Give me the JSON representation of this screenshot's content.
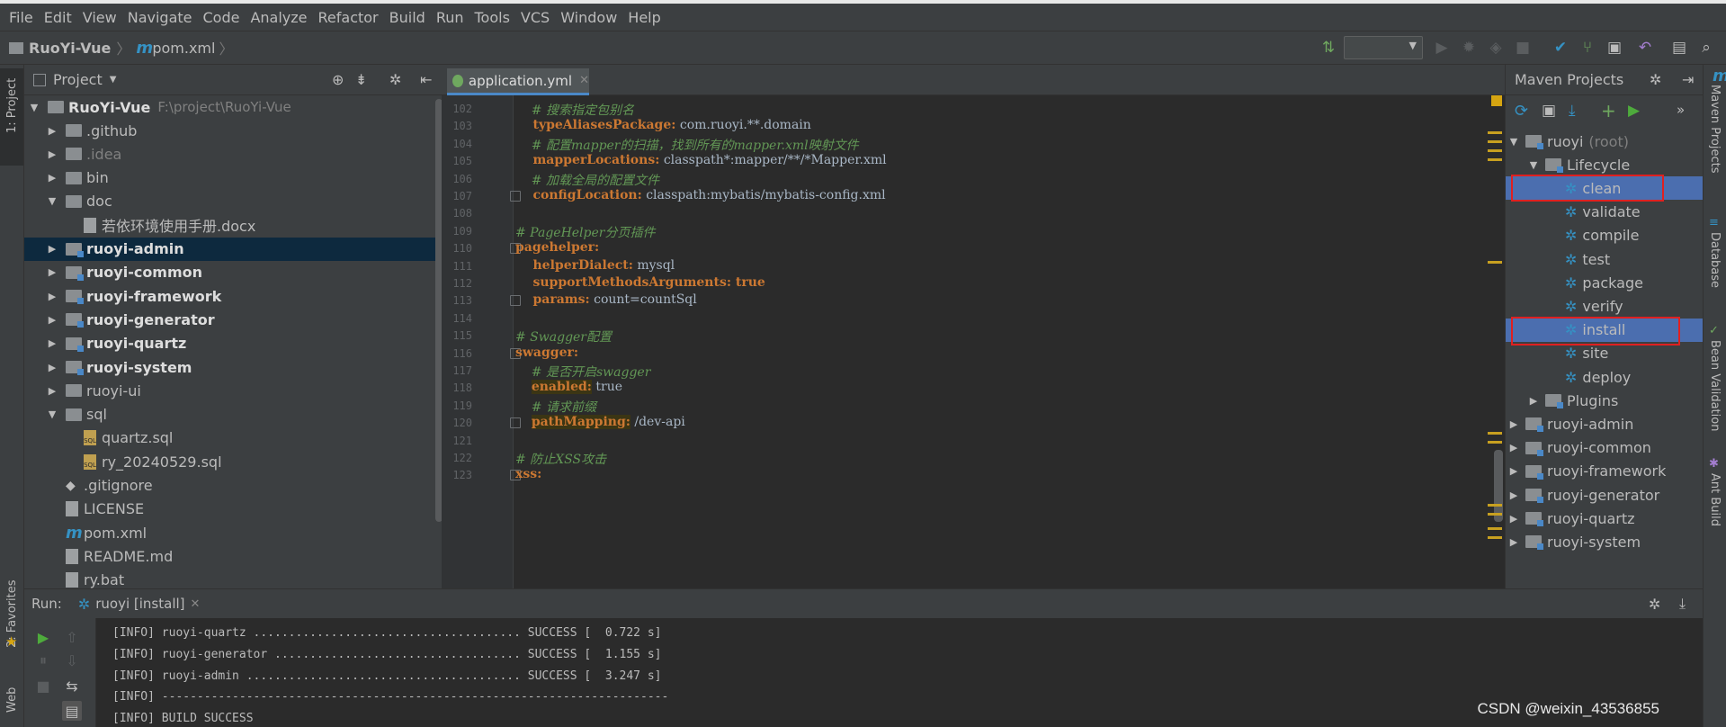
{
  "menu": [
    "File",
    "Edit",
    "View",
    "Navigate",
    "Code",
    "Analyze",
    "Refactor",
    "Build",
    "Run",
    "Tools",
    "VCS",
    "Window",
    "Help"
  ],
  "breadcrumb": {
    "project": "RuoYi-Vue",
    "file": "pom.xml"
  },
  "left_strip": {
    "project_tab": "1: Project",
    "favorites_tab": "2: Favorites",
    "web_tab": "Web"
  },
  "project_panel": {
    "title": "Project",
    "root_name": "RuoYi-Vue",
    "root_path": "F:\\project\\RuoYi-Vue",
    "items": [
      {
        "label": ".github"
      },
      {
        "label": ".idea"
      },
      {
        "label": "bin"
      },
      {
        "label": "doc"
      },
      {
        "label": "若依环境使用手册.docx"
      },
      {
        "label": "ruoyi-admin"
      },
      {
        "label": "ruoyi-common"
      },
      {
        "label": "ruoyi-framework"
      },
      {
        "label": "ruoyi-generator"
      },
      {
        "label": "ruoyi-quartz"
      },
      {
        "label": "ruoyi-system"
      },
      {
        "label": "ruoyi-ui"
      },
      {
        "label": "sql"
      },
      {
        "label": "quartz.sql"
      },
      {
        "label": "ry_20240529.sql"
      },
      {
        "label": ".gitignore"
      },
      {
        "label": "LICENSE"
      },
      {
        "label": "pom.xml"
      },
      {
        "label": "README.md"
      },
      {
        "label": "ry.bat"
      }
    ]
  },
  "editor": {
    "tab": "application.yml",
    "lines": [
      {
        "n": "102",
        "parts": [
          {
            "t": "    # 搜索指定包别名",
            "s": "c"
          }
        ]
      },
      {
        "n": "103",
        "parts": [
          {
            "t": "    typeAliasesPackage:",
            "s": "k"
          },
          {
            "t": " com.ruoyi.**.domain",
            "s": "v"
          }
        ]
      },
      {
        "n": "104",
        "parts": [
          {
            "t": "    # 配置mapper的扫描，找到所有的mapper.xml映射文件",
            "s": "c"
          }
        ]
      },
      {
        "n": "105",
        "parts": [
          {
            "t": "    mapperLocations:",
            "s": "k"
          },
          {
            "t": " classpath*:mapper/**/*Mapper.xml",
            "s": "v"
          }
        ]
      },
      {
        "n": "106",
        "parts": [
          {
            "t": "    # 加载全局的配置文件",
            "s": "c"
          }
        ]
      },
      {
        "n": "107",
        "parts": [
          {
            "t": "    configLocation:",
            "s": "k"
          },
          {
            "t": " classpath:mybatis/mybatis-config.xml",
            "s": "v"
          }
        ]
      },
      {
        "n": "108",
        "parts": []
      },
      {
        "n": "109",
        "parts": [
          {
            "t": "# PageHelper分页插件",
            "s": "c"
          }
        ]
      },
      {
        "n": "110",
        "parts": [
          {
            "t": "pagehelper:",
            "s": "k"
          }
        ]
      },
      {
        "n": "111",
        "parts": [
          {
            "t": "    helperDialect:",
            "s": "k"
          },
          {
            "t": " mysql",
            "s": "v"
          }
        ]
      },
      {
        "n": "112",
        "parts": [
          {
            "t": "    supportMethodsArguments:",
            "s": "k"
          },
          {
            "t": " true",
            "s": "k"
          }
        ]
      },
      {
        "n": "113",
        "parts": [
          {
            "t": "    params:",
            "s": "k"
          },
          {
            "t": " count=countSql",
            "s": "v"
          }
        ]
      },
      {
        "n": "114",
        "parts": []
      },
      {
        "n": "115",
        "parts": [
          {
            "t": "# Swagger配置",
            "s": "c"
          }
        ]
      },
      {
        "n": "116",
        "parts": [
          {
            "t": "swagger:",
            "s": "k"
          }
        ]
      },
      {
        "n": "117",
        "parts": [
          {
            "t": "    # 是否开启swagger",
            "s": "c"
          }
        ]
      },
      {
        "n": "118",
        "parts": [
          {
            "t": "    ",
            "s": "v"
          },
          {
            "t": "enabled:",
            "s": "khl"
          },
          {
            "t": " true",
            "s": "v"
          }
        ]
      },
      {
        "n": "119",
        "parts": [
          {
            "t": "    # 请求前缀",
            "s": "c"
          }
        ]
      },
      {
        "n": "120",
        "parts": [
          {
            "t": "    ",
            "s": "v"
          },
          {
            "t": "pathMapping:",
            "s": "khl"
          },
          {
            "t": " /dev-api",
            "s": "v"
          }
        ]
      },
      {
        "n": "121",
        "parts": []
      },
      {
        "n": "122",
        "parts": [
          {
            "t": "# 防止XSS攻击",
            "s": "c"
          }
        ]
      },
      {
        "n": "123",
        "parts": [
          {
            "t": "xss:",
            "s": "k"
          }
        ]
      }
    ]
  },
  "maven": {
    "title": "Maven Projects",
    "root": "ruoyi",
    "root_suffix": "(root)",
    "lifecycle": "Lifecycle",
    "goals": [
      "clean",
      "validate",
      "compile",
      "test",
      "package",
      "verify",
      "install",
      "site",
      "deploy"
    ],
    "plugins": "Plugins",
    "modules": [
      "ruoyi-admin",
      "ruoyi-common",
      "ruoyi-framework",
      "ruoyi-generator",
      "ruoyi-quartz",
      "ruoyi-system"
    ]
  },
  "right_strip": {
    "maven": "Maven Projects",
    "database": "Database",
    "bean": "Bean Validation",
    "ant": "Ant Build"
  },
  "run": {
    "label": "Run:",
    "tab": "ruoyi [install]",
    "console": [
      "[INFO] ruoyi-quartz ...................................... SUCCESS [  0.722 s]",
      "[INFO] ruoyi-generator ................................... SUCCESS [  1.155 s]",
      "[INFO] ruoyi-admin ....................................... SUCCESS [  3.247 s]",
      "[INFO] ------------------------------------------------------------------------",
      "[INFO] BUILD SUCCESS"
    ]
  },
  "watermark": "CSDN @weixin_43536855",
  "colors": {
    "background": "#2b2b2b",
    "panel": "#3c3f41",
    "selection": "#4b6eaf",
    "keyword": "#cc7832",
    "comment": "#629755",
    "highlight_box": "#e02020"
  }
}
